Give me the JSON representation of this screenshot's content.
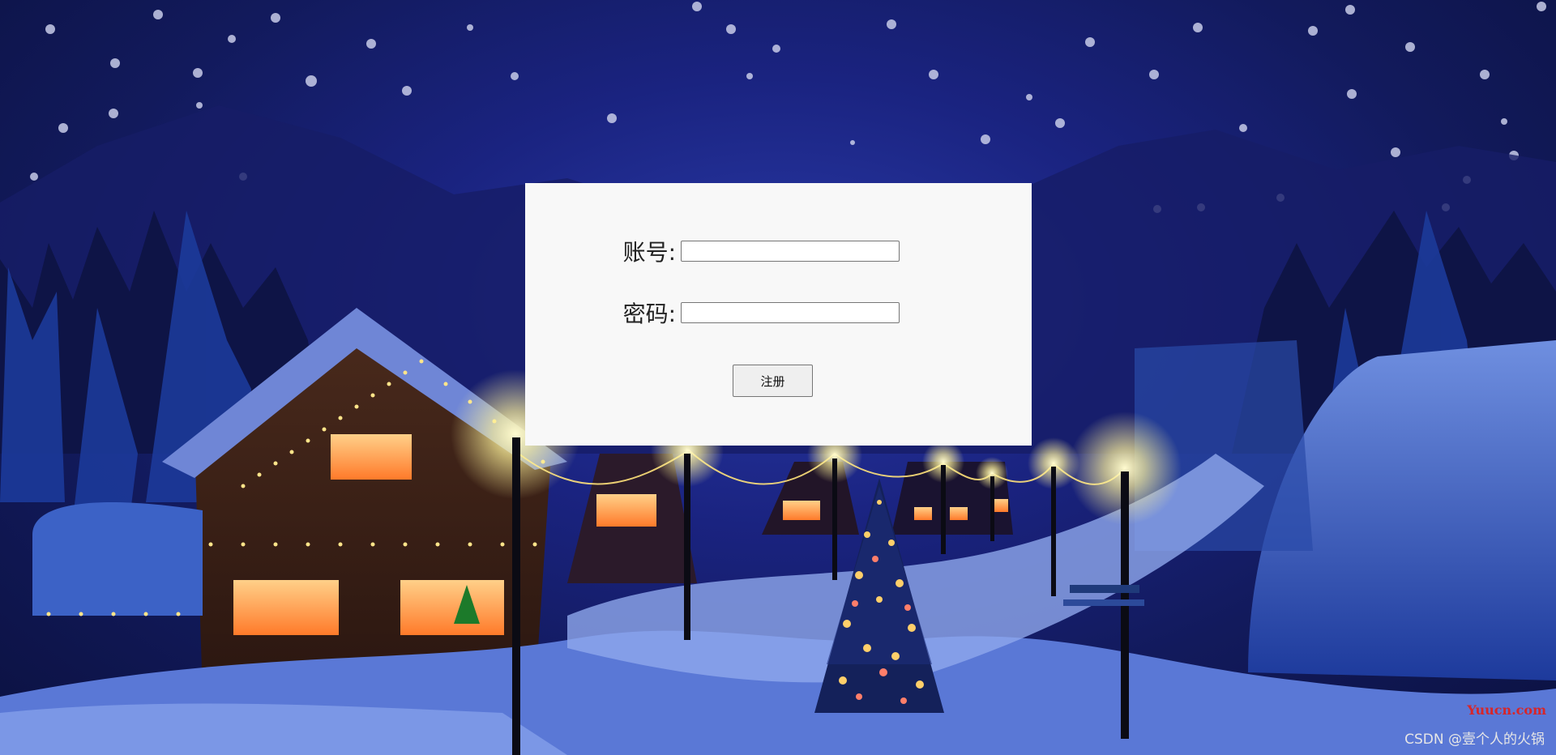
{
  "form": {
    "account_label": "账号:",
    "account_value": "",
    "password_label": "密码:",
    "password_value": "",
    "submit_label": "注册"
  },
  "watermark": {
    "site": "Yuucn.com",
    "author": "CSDN @壹个人的火锅"
  },
  "background": {
    "description_colors": {
      "sky_top": "#121a5c",
      "sky_center": "#2a3aa8",
      "snow": "#9fb6e8",
      "lamp_glow": "#fff7a8",
      "window_glow": "#ff9a3c"
    }
  }
}
